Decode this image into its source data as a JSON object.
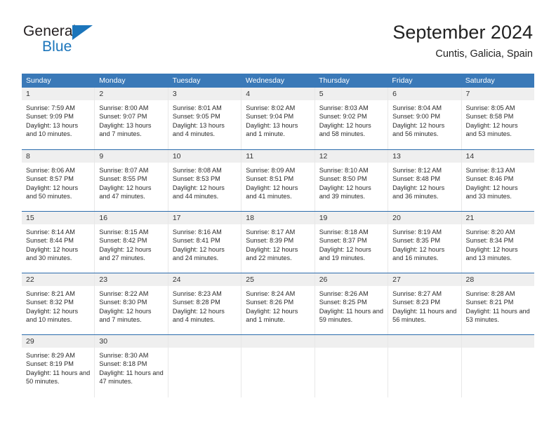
{
  "brand": {
    "name_top": "General",
    "name_bottom": "Blue",
    "accent_color": "#1b75bb"
  },
  "header": {
    "title": "September 2024",
    "subtitle": "Cuntis, Galicia, Spain"
  },
  "calendar": {
    "header_bg": "#3a79b8",
    "weekdays": [
      "Sunday",
      "Monday",
      "Tuesday",
      "Wednesday",
      "Thursday",
      "Friday",
      "Saturday"
    ],
    "weeks": [
      [
        {
          "day": "1",
          "sunrise": "Sunrise: 7:59 AM",
          "sunset": "Sunset: 9:09 PM",
          "daylight": "Daylight: 13 hours and 10 minutes."
        },
        {
          "day": "2",
          "sunrise": "Sunrise: 8:00 AM",
          "sunset": "Sunset: 9:07 PM",
          "daylight": "Daylight: 13 hours and 7 minutes."
        },
        {
          "day": "3",
          "sunrise": "Sunrise: 8:01 AM",
          "sunset": "Sunset: 9:05 PM",
          "daylight": "Daylight: 13 hours and 4 minutes."
        },
        {
          "day": "4",
          "sunrise": "Sunrise: 8:02 AM",
          "sunset": "Sunset: 9:04 PM",
          "daylight": "Daylight: 13 hours and 1 minute."
        },
        {
          "day": "5",
          "sunrise": "Sunrise: 8:03 AM",
          "sunset": "Sunset: 9:02 PM",
          "daylight": "Daylight: 12 hours and 58 minutes."
        },
        {
          "day": "6",
          "sunrise": "Sunrise: 8:04 AM",
          "sunset": "Sunset: 9:00 PM",
          "daylight": "Daylight: 12 hours and 56 minutes."
        },
        {
          "day": "7",
          "sunrise": "Sunrise: 8:05 AM",
          "sunset": "Sunset: 8:58 PM",
          "daylight": "Daylight: 12 hours and 53 minutes."
        }
      ],
      [
        {
          "day": "8",
          "sunrise": "Sunrise: 8:06 AM",
          "sunset": "Sunset: 8:57 PM",
          "daylight": "Daylight: 12 hours and 50 minutes."
        },
        {
          "day": "9",
          "sunrise": "Sunrise: 8:07 AM",
          "sunset": "Sunset: 8:55 PM",
          "daylight": "Daylight: 12 hours and 47 minutes."
        },
        {
          "day": "10",
          "sunrise": "Sunrise: 8:08 AM",
          "sunset": "Sunset: 8:53 PM",
          "daylight": "Daylight: 12 hours and 44 minutes."
        },
        {
          "day": "11",
          "sunrise": "Sunrise: 8:09 AM",
          "sunset": "Sunset: 8:51 PM",
          "daylight": "Daylight: 12 hours and 41 minutes."
        },
        {
          "day": "12",
          "sunrise": "Sunrise: 8:10 AM",
          "sunset": "Sunset: 8:50 PM",
          "daylight": "Daylight: 12 hours and 39 minutes."
        },
        {
          "day": "13",
          "sunrise": "Sunrise: 8:12 AM",
          "sunset": "Sunset: 8:48 PM",
          "daylight": "Daylight: 12 hours and 36 minutes."
        },
        {
          "day": "14",
          "sunrise": "Sunrise: 8:13 AM",
          "sunset": "Sunset: 8:46 PM",
          "daylight": "Daylight: 12 hours and 33 minutes."
        }
      ],
      [
        {
          "day": "15",
          "sunrise": "Sunrise: 8:14 AM",
          "sunset": "Sunset: 8:44 PM",
          "daylight": "Daylight: 12 hours and 30 minutes."
        },
        {
          "day": "16",
          "sunrise": "Sunrise: 8:15 AM",
          "sunset": "Sunset: 8:42 PM",
          "daylight": "Daylight: 12 hours and 27 minutes."
        },
        {
          "day": "17",
          "sunrise": "Sunrise: 8:16 AM",
          "sunset": "Sunset: 8:41 PM",
          "daylight": "Daylight: 12 hours and 24 minutes."
        },
        {
          "day": "18",
          "sunrise": "Sunrise: 8:17 AM",
          "sunset": "Sunset: 8:39 PM",
          "daylight": "Daylight: 12 hours and 22 minutes."
        },
        {
          "day": "19",
          "sunrise": "Sunrise: 8:18 AM",
          "sunset": "Sunset: 8:37 PM",
          "daylight": "Daylight: 12 hours and 19 minutes."
        },
        {
          "day": "20",
          "sunrise": "Sunrise: 8:19 AM",
          "sunset": "Sunset: 8:35 PM",
          "daylight": "Daylight: 12 hours and 16 minutes."
        },
        {
          "day": "21",
          "sunrise": "Sunrise: 8:20 AM",
          "sunset": "Sunset: 8:34 PM",
          "daylight": "Daylight: 12 hours and 13 minutes."
        }
      ],
      [
        {
          "day": "22",
          "sunrise": "Sunrise: 8:21 AM",
          "sunset": "Sunset: 8:32 PM",
          "daylight": "Daylight: 12 hours and 10 minutes."
        },
        {
          "day": "23",
          "sunrise": "Sunrise: 8:22 AM",
          "sunset": "Sunset: 8:30 PM",
          "daylight": "Daylight: 12 hours and 7 minutes."
        },
        {
          "day": "24",
          "sunrise": "Sunrise: 8:23 AM",
          "sunset": "Sunset: 8:28 PM",
          "daylight": "Daylight: 12 hours and 4 minutes."
        },
        {
          "day": "25",
          "sunrise": "Sunrise: 8:24 AM",
          "sunset": "Sunset: 8:26 PM",
          "daylight": "Daylight: 12 hours and 1 minute."
        },
        {
          "day": "26",
          "sunrise": "Sunrise: 8:26 AM",
          "sunset": "Sunset: 8:25 PM",
          "daylight": "Daylight: 11 hours and 59 minutes."
        },
        {
          "day": "27",
          "sunrise": "Sunrise: 8:27 AM",
          "sunset": "Sunset: 8:23 PM",
          "daylight": "Daylight: 11 hours and 56 minutes."
        },
        {
          "day": "28",
          "sunrise": "Sunrise: 8:28 AM",
          "sunset": "Sunset: 8:21 PM",
          "daylight": "Daylight: 11 hours and 53 minutes."
        }
      ],
      [
        {
          "day": "29",
          "sunrise": "Sunrise: 8:29 AM",
          "sunset": "Sunset: 8:19 PM",
          "daylight": "Daylight: 11 hours and 50 minutes."
        },
        {
          "day": "30",
          "sunrise": "Sunrise: 8:30 AM",
          "sunset": "Sunset: 8:18 PM",
          "daylight": "Daylight: 11 hours and 47 minutes."
        },
        {
          "day": "",
          "sunrise": "",
          "sunset": "",
          "daylight": ""
        },
        {
          "day": "",
          "sunrise": "",
          "sunset": "",
          "daylight": ""
        },
        {
          "day": "",
          "sunrise": "",
          "sunset": "",
          "daylight": ""
        },
        {
          "day": "",
          "sunrise": "",
          "sunset": "",
          "daylight": ""
        },
        {
          "day": "",
          "sunrise": "",
          "sunset": "",
          "daylight": ""
        }
      ]
    ]
  }
}
